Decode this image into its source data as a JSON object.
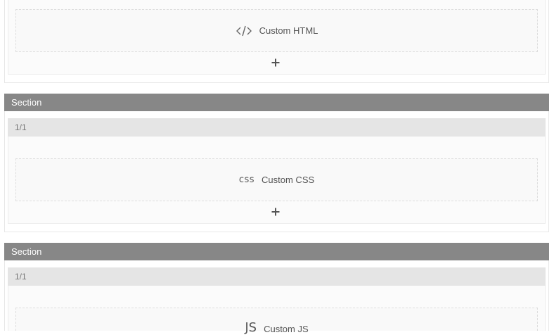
{
  "blocks": [
    {
      "section_label": "",
      "column_label": "",
      "element": {
        "icon": "code-icon",
        "icon_text": "",
        "label": "Custom HTML"
      },
      "add_label": "+"
    },
    {
      "section_label": "Section",
      "column_label": "1/1",
      "element": {
        "icon": "css-icon",
        "icon_text": "css",
        "label": "Custom CSS"
      },
      "add_label": "+"
    },
    {
      "section_label": "Section",
      "column_label": "1/1",
      "element": {
        "icon": "js-icon",
        "icon_text": "JS",
        "label": "Custom JS"
      },
      "add_label": ""
    }
  ],
  "colors": {
    "section_bar": "#878787",
    "column_bar": "#e5e5e5",
    "element_border": "#dedede",
    "text": "#555555"
  }
}
